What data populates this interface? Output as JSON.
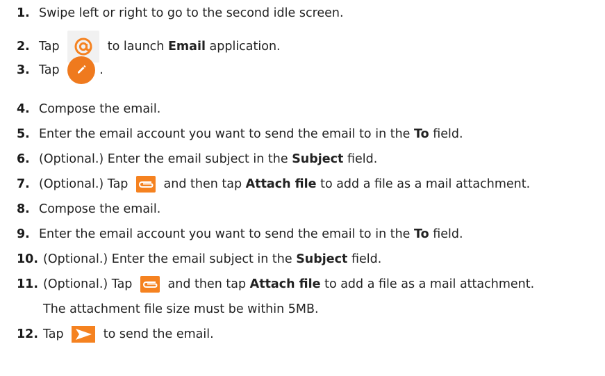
{
  "steps": [
    {
      "number": "1.",
      "parts": [
        {
          "t": "Swipe left or right to go to the second idle screen."
        }
      ]
    },
    {
      "number": "2.",
      "parts": [
        {
          "t": "Tap "
        },
        {
          "icon": "email-at-icon"
        },
        {
          "t": " to launch "
        },
        {
          "t": "Email",
          "bold": true
        },
        {
          "t": " application."
        }
      ]
    },
    {
      "number": "3.",
      "parts": [
        {
          "t": "Tap "
        },
        {
          "icon": "compose-pencil-icon"
        },
        {
          "t": "."
        }
      ]
    },
    {
      "number": "4.",
      "parts": [
        {
          "t": "Compose the email."
        }
      ]
    },
    {
      "number": "5.",
      "parts": [
        {
          "t": "Enter the email account you want to send the email to in the "
        },
        {
          "t": "To",
          "bold": true
        },
        {
          "t": " field."
        }
      ]
    },
    {
      "number": "6.",
      "parts": [
        {
          "t": "(Optional.) Enter the email subject in the "
        },
        {
          "t": "Subject",
          "bold": true
        },
        {
          "t": " field."
        }
      ]
    },
    {
      "number": "7.",
      "parts": [
        {
          "t": "(Optional.) Tap "
        },
        {
          "icon": "paperclip-icon"
        },
        {
          "t": " and then tap "
        },
        {
          "t": "Attach file",
          "bold": true
        },
        {
          "t": " to add a file as a mail attachment."
        }
      ]
    },
    {
      "number": "8.",
      "parts": [
        {
          "t": "Compose the email."
        }
      ]
    },
    {
      "number": "9.",
      "parts": [
        {
          "t": "Enter the email account you want to send the email to in the "
        },
        {
          "t": "To",
          "bold": true
        },
        {
          "t": " field."
        }
      ]
    },
    {
      "number": "10.",
      "parts": [
        {
          "t": "(Optional.) Enter the email subject in the "
        },
        {
          "t": "Subject",
          "bold": true
        },
        {
          "t": " field."
        }
      ]
    },
    {
      "number": "11.",
      "parts": [
        {
          "t": "(Optional.) Tap "
        },
        {
          "icon": "paperclip-icon"
        },
        {
          "t": " and then tap "
        },
        {
          "t": "Attach file",
          "bold": true
        },
        {
          "t": " to add a file as a mail attachment."
        }
      ]
    },
    {
      "number": "12.",
      "parts": [
        {
          "t": "Tap "
        },
        {
          "icon": "send-arrow-icon"
        },
        {
          "t": " to send the email."
        }
      ]
    }
  ],
  "step11_continuation": "The attachment file size must be within 5MB.",
  "colors": {
    "accent_orange": "#f58220",
    "compose_orange": "#ef7a1e",
    "at_icon_bg": "#f1f1f1"
  }
}
